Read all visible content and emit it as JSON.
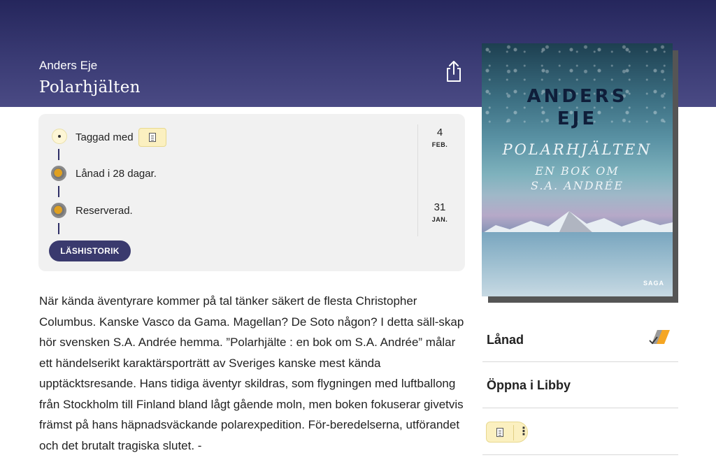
{
  "header": {
    "author": "Anders Eje",
    "title": "Polarhjälten",
    "share_icon": "share-icon"
  },
  "activity": {
    "events": [
      {
        "text": "Taggad med",
        "icon": "tag-notepad-icon"
      },
      {
        "text": "Lånad i 28 dagar."
      },
      {
        "text": "Reserverad."
      }
    ],
    "dates": [
      {
        "day": "4",
        "month": "FEB."
      },
      {
        "day": "31",
        "month": "JAN."
      }
    ],
    "history_button": "LÄSHISTORIK"
  },
  "description": "När kända äventyrare kommer på tal tänker säkert de flesta Christopher Columbus. Kanske Vasco da Gama. Magellan? De Soto någon? I detta säll-skap hör svensken S.A. Andrée hemma. ”Polarhjälte : en bok om S.A. Andrée” målar ett händelserikt karaktärsporträtt av Sveriges kanske mest kända upptäcktsresande. Hans tidiga äventyr skildras, som flygningen med luftballong från Stockholm till Finland bland lågt gående moln, men boken fokuserar givetvis främst på hans häpnadsväckande polarexpedition. För-beredelserna, utförandet och det brutalt tragiska slutet. -",
  "cover": {
    "author_line1": "ANDERS",
    "author_line2": "EJE",
    "title": "POLARHJÄLTEN",
    "subtitle_line1": "EN BOK OM",
    "subtitle_line2": "S.A. ANDRÉE",
    "publisher": "SAGA"
  },
  "side": {
    "loan_label": "Lånad",
    "open_label": "Öppna i Libby",
    "more_glyph": "⋮"
  },
  "colors": {
    "header_top": "#25265c",
    "accent_button": "#3a3a6e",
    "tag_yellow": "#fbf0c0",
    "loan_orange": "#f5a623"
  }
}
